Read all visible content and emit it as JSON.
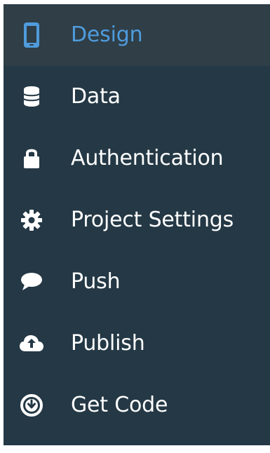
{
  "sidebar": {
    "items": [
      {
        "label": "Design",
        "icon": "mobile-phone-icon",
        "active": true
      },
      {
        "label": "Data",
        "icon": "database-icon",
        "active": false
      },
      {
        "label": "Authentication",
        "icon": "lock-icon",
        "active": false
      },
      {
        "label": "Project Settings",
        "icon": "gear-icon",
        "active": false
      },
      {
        "label": "Push",
        "icon": "chat-bubble-icon",
        "active": false
      },
      {
        "label": "Publish",
        "icon": "cloud-upload-icon",
        "active": false
      },
      {
        "label": "Get Code",
        "icon": "download-circle-icon",
        "active": false
      }
    ]
  },
  "colors": {
    "sidebar_background": "#243845",
    "active_background": "#2f3e47",
    "active_text": "#4f9bdc",
    "inactive_text": "#ffffff",
    "page_background": "#ffffff"
  }
}
